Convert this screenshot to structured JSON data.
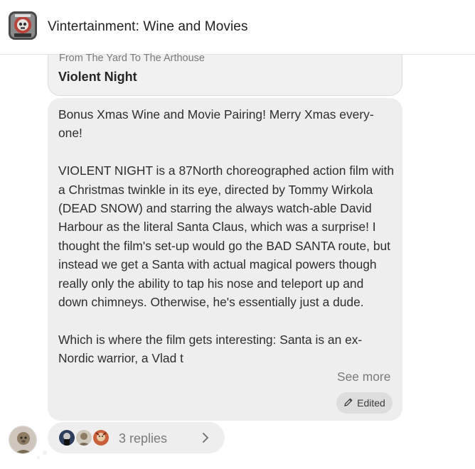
{
  "channel": {
    "title": "Vintertainment: Wine and Movies",
    "avatar_icon": "channel-avatar-skull-icon"
  },
  "quoted_post": {
    "source": "From The Yard To The Arthouse",
    "title": "Violent Night"
  },
  "message": {
    "paragraphs": [
      "Bonus Xmas Wine and Movie Pairing! Merry Xmas every-one!",
      "VIOLENT NIGHT is a 87North choreographed action film with a Christmas twinkle in its eye, directed by Tommy Wirkola (DEAD SNOW) and starring the always watch-able David Harbour as the literal Santa Claus, which was a surprise! I thought the film's set-up would go the BAD SANTA route, but instead we get a Santa with actual magical powers though really only the ability to tap his nose and teleport up and down chimneys. Otherwise, he's essentially just a dude.",
      "Which is where the film gets interesting: Santa is an ex-Nordic warrior, a Vlad t"
    ],
    "see_more": "See more",
    "edited_label": "Edited",
    "edited_icon": "pencil-icon"
  },
  "replies": {
    "label": "3 replies",
    "avatar_icons": [
      "reply-avatar-1",
      "reply-avatar-2",
      "reply-avatar-3"
    ],
    "chevron_icon": "chevron-right-icon"
  },
  "author": {
    "avatar_icon": "user-avatar-icon"
  }
}
